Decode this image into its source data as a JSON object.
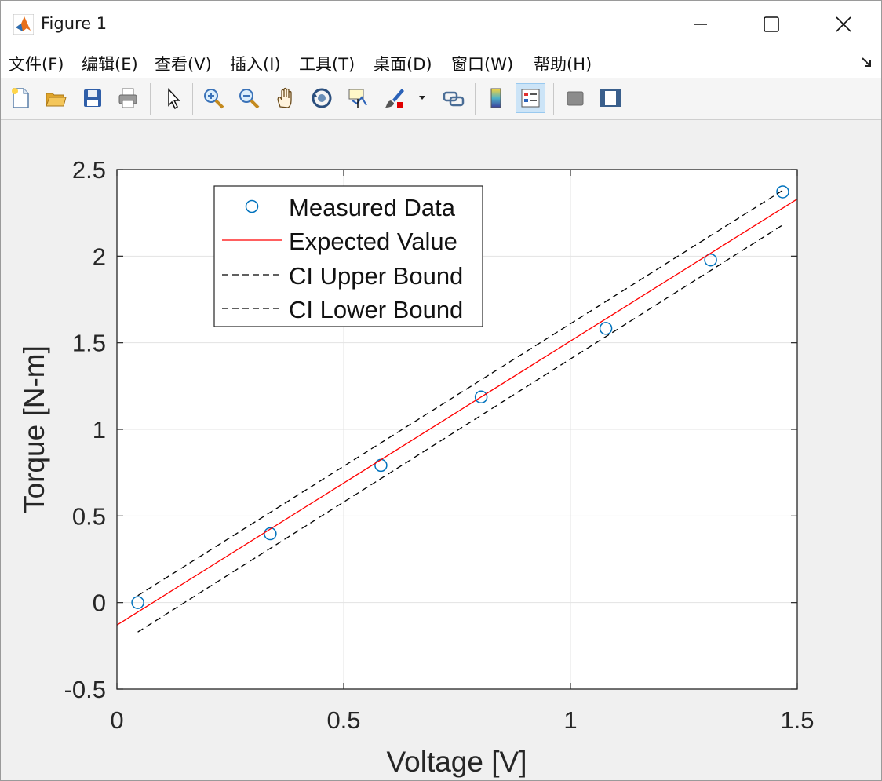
{
  "window": {
    "title": "Figure 1",
    "minimize_icon": "minimize-icon",
    "maximize_icon": "maximize-icon",
    "close_icon": "close-icon"
  },
  "menu": {
    "items": [
      "文件(F)",
      "编辑(E)",
      "查看(V)",
      "插入(I)",
      "工具(T)",
      "桌面(D)",
      "窗口(W)",
      "帮助(H)"
    ]
  },
  "toolbar": {
    "icons": [
      "new-figure-icon",
      "open-file-icon",
      "save-icon",
      "print-icon",
      "pointer-icon",
      "zoom-in-icon",
      "zoom-out-icon",
      "pan-icon",
      "rotate-3d-icon",
      "data-cursor-icon",
      "brush-icon",
      "link-plot-icon",
      "colorbar-icon",
      "legend-icon",
      "hide-plot-tools-icon",
      "show-plot-tools-icon"
    ]
  },
  "colors": {
    "measured": "#0072bd",
    "expected": "#ff0000",
    "bounds": "#000000"
  },
  "chart_data": {
    "type": "line",
    "title": "",
    "xlabel": "Voltage [V]",
    "ylabel": "Torque [N-m]",
    "xlim": [
      0,
      1.5
    ],
    "ylim": [
      -0.5,
      2.5
    ],
    "xticks": [
      0,
      0.5,
      1,
      1.5
    ],
    "xtick_labels": [
      "0",
      "0.5",
      "1",
      "1.5"
    ],
    "yticks": [
      -0.5,
      0,
      0.5,
      1,
      1.5,
      2,
      2.5
    ],
    "ytick_labels": [
      "-0.5",
      "0",
      "0.5",
      "1",
      "1.5",
      "2",
      "2.5"
    ],
    "grid": true,
    "legend_position": "top-left",
    "series": [
      {
        "name": "Measured Data",
        "style": "markers-circle",
        "color": "#0072bd",
        "x": [
          0.046,
          0.338,
          0.582,
          0.803,
          1.078,
          1.309,
          1.468
        ],
        "y": [
          0.0,
          0.397,
          0.792,
          1.187,
          1.583,
          1.978,
          2.371
        ]
      },
      {
        "name": "Expected Value",
        "style": "solid",
        "color": "#ff0000",
        "x": [
          0,
          1.5
        ],
        "y": [
          -0.13,
          2.33
        ]
      },
      {
        "name": "CI Upper Bound",
        "style": "dashed",
        "color": "#000000",
        "x": [
          0.046,
          1.468
        ],
        "y": [
          0.04,
          2.38
        ]
      },
      {
        "name": "CI Lower Bound",
        "style": "dashed",
        "color": "#000000",
        "x": [
          0.046,
          1.468
        ],
        "y": [
          -0.17,
          2.18
        ]
      }
    ]
  }
}
